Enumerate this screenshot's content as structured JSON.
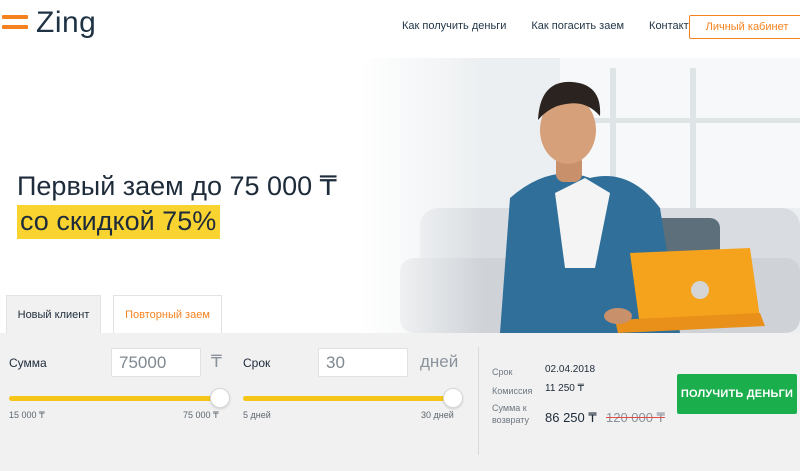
{
  "brand": {
    "name": "Zing",
    "accent": "#f5821f",
    "highlight": "#f9d330",
    "cta_color": "#1aae4c"
  },
  "nav": {
    "items": [
      "Как получить деньги",
      "Как погасить заем",
      "Контакты"
    ],
    "cabinet": "Личный кабинет"
  },
  "hero": {
    "headline_line1": "Первый заем до 75 000 ₸",
    "headline_line2": "со скидкой 75%"
  },
  "tabs": {
    "new_client": "Новый клиент",
    "repeat_loan": "Повторный заем"
  },
  "calculator": {
    "amount": {
      "label": "Сумма",
      "value": "75000",
      "unit": "₸",
      "min_label": "15 000 ₸",
      "max_label": "75 000 ₸",
      "fill_fraction": 1.0
    },
    "term": {
      "label": "Срок",
      "value": "30",
      "unit": "дней",
      "min_label": "5 дней",
      "max_label": "30 дней",
      "fill_fraction": 1.0
    }
  },
  "summary": {
    "term_label": "Срок",
    "term_value": "02.04.2018",
    "fee_label": "Комиссия",
    "fee_value": "11 250 ₸",
    "total_label": "Сумма к возврату",
    "total_value": "86 250 ₸",
    "old_total_value": "120 000 ₸"
  },
  "cta": {
    "label": "ПОЛУЧИТЬ ДЕНЬГИ"
  }
}
